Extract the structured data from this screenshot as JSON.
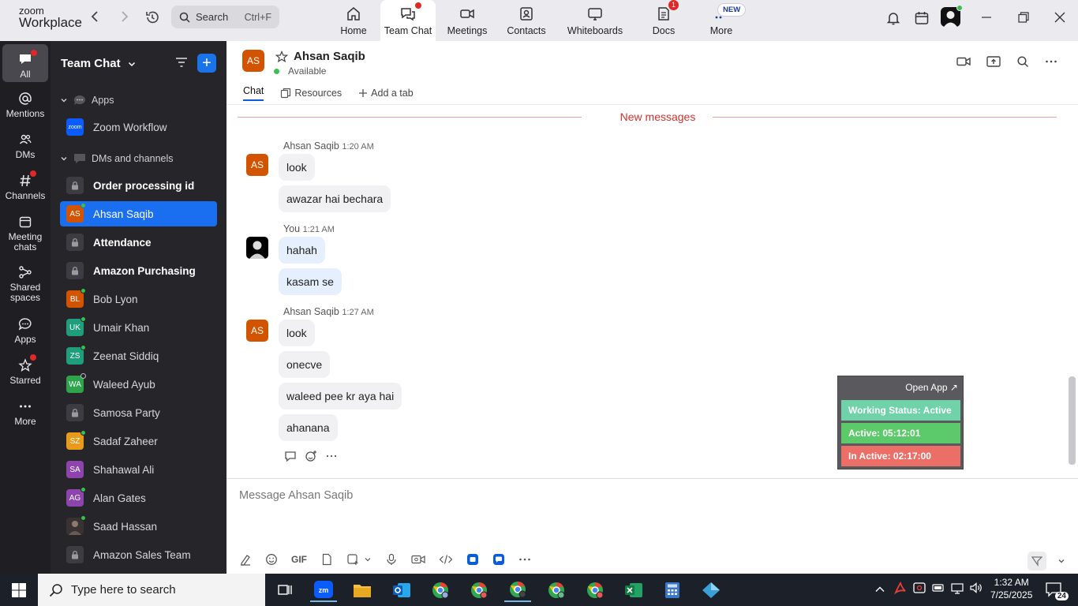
{
  "app": {
    "logo_top": "zoom",
    "logo_bottom": "Workplace"
  },
  "search": {
    "label": "Search",
    "shortcut": "Ctrl+F"
  },
  "top_tabs": [
    {
      "label": "Home"
    },
    {
      "label": "Team Chat"
    },
    {
      "label": "Meetings"
    },
    {
      "label": "Contacts"
    },
    {
      "label": "Whiteboards"
    },
    {
      "label": "Docs",
      "badge": "1"
    },
    {
      "label": "More",
      "badge": "NEW"
    }
  ],
  "rail": [
    {
      "label": "All"
    },
    {
      "label": "Mentions"
    },
    {
      "label": "DMs"
    },
    {
      "label": "Channels"
    },
    {
      "label": "Meeting chats"
    },
    {
      "label": "Shared spaces"
    },
    {
      "label": "Apps"
    },
    {
      "label": "Starred"
    },
    {
      "label": "More"
    }
  ],
  "sidebar": {
    "title": "Team Chat",
    "section_apps": "Apps",
    "app_item": {
      "label": "Zoom Workflow",
      "icon_text": "zoom"
    },
    "section_dms": "DMs and channels",
    "items": [
      {
        "label": "Order processing id"
      },
      {
        "label": "Ahsan Saqib",
        "initials": "AS"
      },
      {
        "label": "Attendance"
      },
      {
        "label": "Amazon Purchasing"
      },
      {
        "label": "Bob Lyon",
        "initials": "BL"
      },
      {
        "label": "Umair Khan",
        "initials": "UK"
      },
      {
        "label": "Zeenat Siddiq",
        "initials": "ZS"
      },
      {
        "label": "Waleed Ayub",
        "initials": "WA"
      },
      {
        "label": "Samosa Party"
      },
      {
        "label": "Sadaf Zaheer",
        "initials": "SZ"
      },
      {
        "label": "Shahawal Ali",
        "initials": "SA"
      },
      {
        "label": "Alan Gates",
        "initials": "AG"
      },
      {
        "label": "Saad Hassan"
      },
      {
        "label": "Amazon Sales Team"
      }
    ]
  },
  "chat": {
    "header": {
      "name": "Ahsan Saqib",
      "initials": "AS",
      "status": "Available"
    },
    "tabs": [
      "Chat",
      "Resources",
      "Add a tab"
    ],
    "new_messages": "New messages",
    "groups": [
      {
        "sender": "Ahsan Saqib",
        "time": "1:20 AM",
        "initials": "AS",
        "messages": [
          "look",
          "awazar hai bechara"
        ]
      },
      {
        "sender": "You",
        "time": "1:21 AM",
        "messages": [
          "hahah",
          "kasam se"
        ]
      },
      {
        "sender": "Ahsan Saqib",
        "time": "1:27 AM",
        "initials": "AS",
        "messages": [
          "look",
          "onecve",
          "waleed pee kr aya hai",
          "ahanana"
        ]
      }
    ],
    "compose_placeholder": "Message Ahsan Saqib",
    "gif_label": "GIF"
  },
  "widget": {
    "open_app": "Open App ↗",
    "working_status": "Working Status: Active",
    "active": "Active: 05:12:01",
    "inactive": "In Active: 02:17:00"
  },
  "taskbar": {
    "search_placeholder": "Type here to search",
    "time": "1:32 AM",
    "date": "7/25/2025",
    "notifications": "24"
  },
  "colors": {
    "accent": "#1a6ef0",
    "avatar_orange": "#d35400",
    "new_messages": "#d0312d",
    "widget_green_status": "#6fd2a8",
    "widget_green": "#5cc96b",
    "widget_red": "#ec6f67"
  }
}
